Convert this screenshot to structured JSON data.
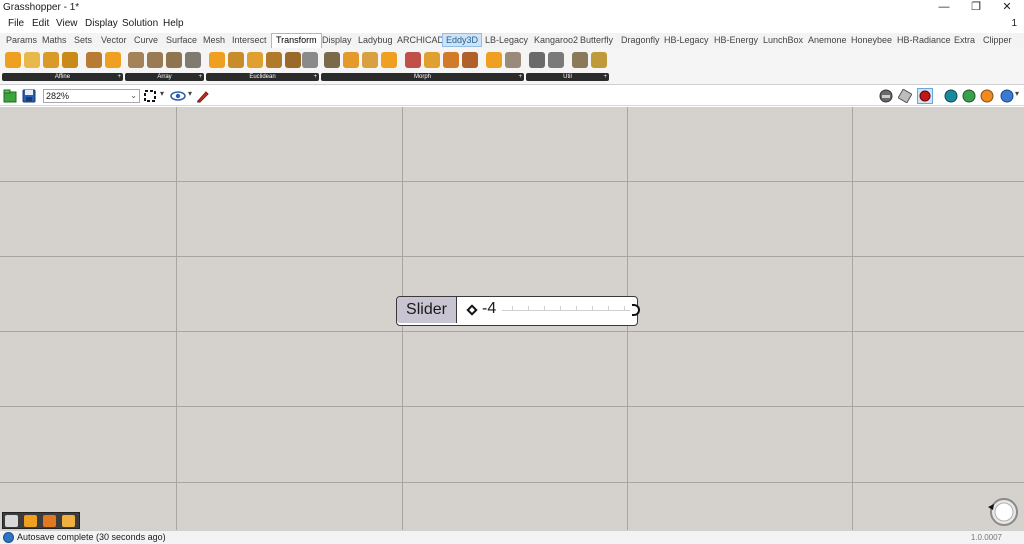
{
  "window": {
    "title": "Grasshopper - 1*",
    "minimize_glyph": "—",
    "restore_glyph": "❐",
    "close_glyph": "✕"
  },
  "menu": {
    "items": [
      "File",
      "Edit",
      "View",
      "Display",
      "Solution",
      "Help"
    ],
    "right_count": "1"
  },
  "tabs": [
    "Params",
    "Maths",
    "Sets",
    "Vector",
    "Curve",
    "Surface",
    "Mesh",
    "Intersect",
    "Transform",
    "Display",
    "Ladybug",
    "ARCHICAD",
    "Eddy3D",
    "LB-Legacy",
    "Kangaroo2",
    "Butterfly",
    "Dragonfly",
    "HB-Legacy",
    "HB-Energy",
    "LunchBox",
    "Anemone",
    "Honeybee",
    "HB-Radiance",
    "Extra",
    "Clipper"
  ],
  "active_tab": "Transform",
  "highlighted_tab": "Eddy3D",
  "ribbon_groups": [
    {
      "label": "Affine",
      "expand": "+"
    },
    {
      "label": "Array",
      "expand": "+"
    },
    {
      "label": "Euclidean",
      "expand": "+"
    },
    {
      "label": "Morph",
      "expand": "+"
    },
    {
      "label": "Util",
      "expand": "+"
    }
  ],
  "canvas_toolbar": {
    "zoom": "282%"
  },
  "slider": {
    "name": "Slider",
    "value": "-4"
  },
  "status": {
    "message": "Autosave complete (30 seconds ago)",
    "version": "1.0.0007"
  },
  "colors": {
    "canvas_bg": "#d5d1cc",
    "grid_line": "#a9a5a1",
    "slider_label_bg": "#c8c4d1",
    "icon_orange": "#f0a020"
  }
}
